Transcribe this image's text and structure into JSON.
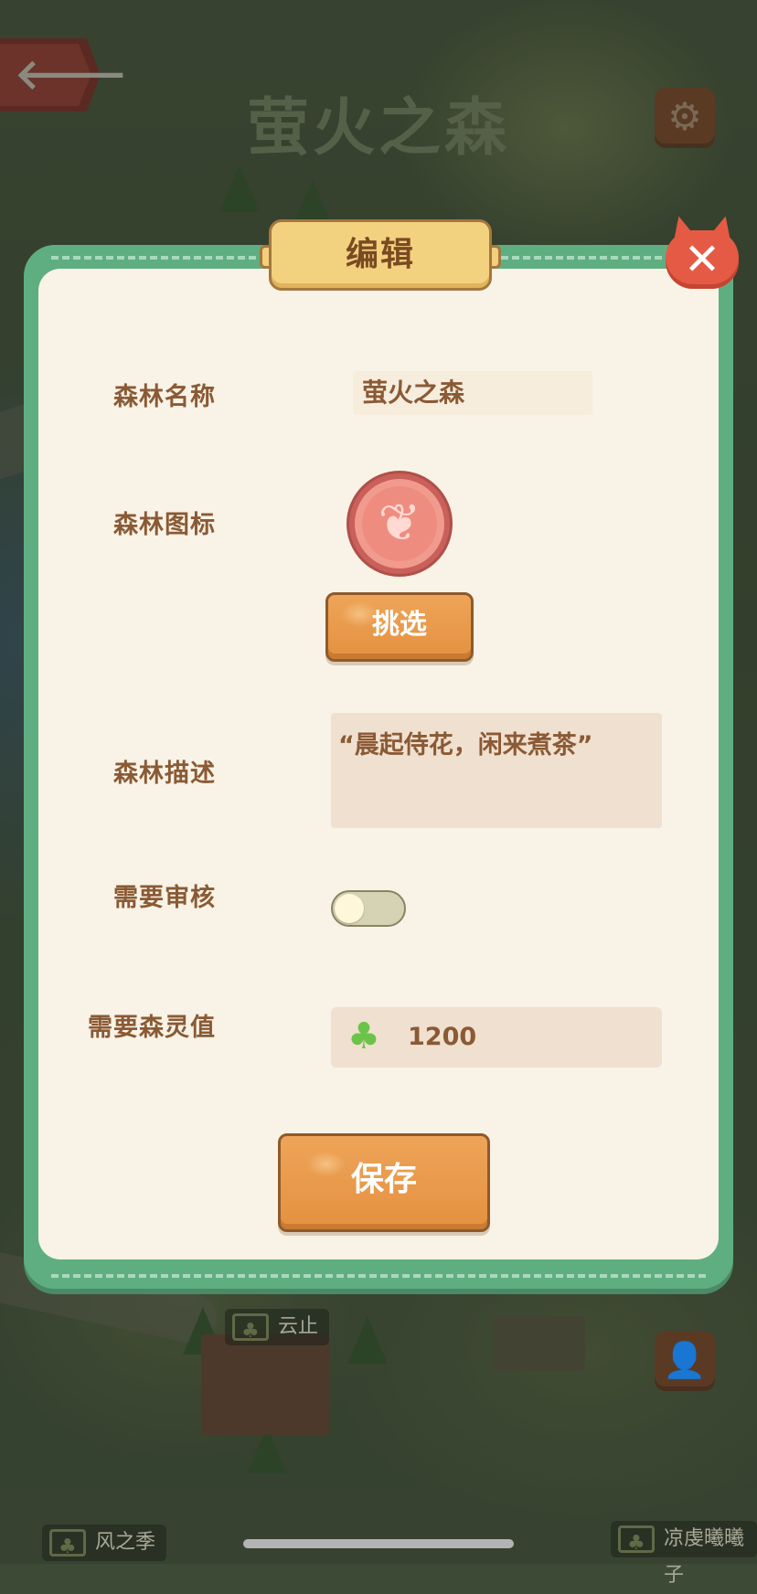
{
  "background": {
    "title": "萤火之森",
    "labels": [
      "云止",
      "风之季",
      "凉虔曦曦子"
    ]
  },
  "dialog": {
    "title": "编辑",
    "close_icon": "close-x-icon",
    "forest_name": {
      "label": "森林名称",
      "value": "萤火之森"
    },
    "forest_icon": {
      "label": "森林图标",
      "icon": "butterfly-icon",
      "pick_label": "挑选"
    },
    "forest_desc": {
      "label": "森林描述",
      "value": "“晨起侍花，闲来煮茶”"
    },
    "need_review": {
      "label": "需要审核",
      "enabled": false
    },
    "spirit_value": {
      "label": "需要森灵值",
      "icon": "clover-icon",
      "value": "1200"
    },
    "save_label": "保存"
  },
  "colors": {
    "frame": "#5fae82",
    "panel": "#f8f3e6",
    "label_text": "#8a5a35",
    "button_wood": "#e4913f",
    "close_red": "#e55a44"
  }
}
